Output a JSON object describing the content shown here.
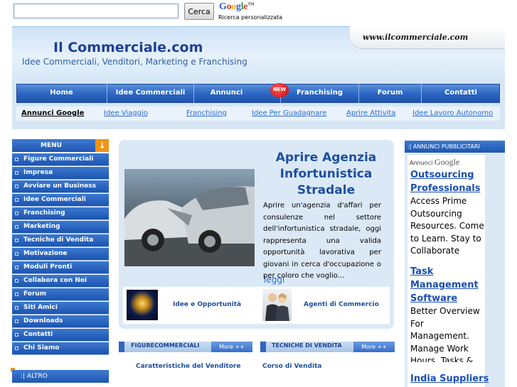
{
  "search": {
    "input_value": "",
    "button_label": "Cerca",
    "google_logo": "Google",
    "google_tm": "TM",
    "subtitle": "Ricerca personalizzata"
  },
  "header": {
    "site_url": "www.ilcommerciale.com",
    "title": "Il Commerciale.com",
    "subtitle": "Idee Commerciali, Venditori, Marketing e Franchising"
  },
  "nav": {
    "items": [
      {
        "label": "Home"
      },
      {
        "label": "Idee Commerciali"
      },
      {
        "label": "Annunci"
      },
      {
        "label": "Franchising"
      },
      {
        "label": "Forum"
      },
      {
        "label": "Contatti"
      }
    ],
    "new_badge": "NEW"
  },
  "subnav": {
    "items": [
      {
        "label": "Annunci Google"
      },
      {
        "label": "Idee Viaggio"
      },
      {
        "label": "Franchising"
      },
      {
        "label": "Idee Per Guadagnare"
      },
      {
        "label": "Aprire Attivita"
      },
      {
        "label": "Idee Lavoro Autonomo"
      }
    ]
  },
  "menu": {
    "title": "MENU",
    "items": [
      {
        "label": "Figure Commerciali"
      },
      {
        "label": "Impresa"
      },
      {
        "label": "Avviare un Business"
      },
      {
        "label": "Idee Commerciali"
      },
      {
        "label": "Franchising"
      },
      {
        "label": "Marketing"
      },
      {
        "label": "Tecniche di Vendita"
      },
      {
        "label": "Motivazione"
      },
      {
        "label": "Moduli Pronti"
      },
      {
        "label": "Collabora con Noi"
      },
      {
        "label": "Forum"
      },
      {
        "label": "Siti Amici"
      },
      {
        "label": "Downloads"
      },
      {
        "label": "Contatti"
      },
      {
        "label": "Chi Siamo"
      }
    ],
    "altro": ":| ALTRO"
  },
  "feature": {
    "title": "Aprire Agenzia Infortunistica Stradale",
    "text": "Aprire un'agenzia d'affari per consulenze nel settore dell'infortunistica stradale, oggi rappresenta una valida opportunità lavorativa per giovani in cerca d'occupazione o per coloro che voglio...",
    "more": "leggi",
    "link1": "Idee e Opportunità",
    "link2": "Agenti di Commercio"
  },
  "sections": {
    "left_title": "FIGURECOMMERCIALI",
    "right_title": "TECNICHE DI VENDITA",
    "more": "More ++",
    "left_link": "Caratteristiche del Venditore",
    "right_link": "Corso di Vendita"
  },
  "ads": {
    "head": ":| ANNUNCI PUBBLICITARI",
    "by": "Annunci",
    "by_brand": "Google",
    "ad1_title_l1": "Outsourcing",
    "ad1_title_l2": "Professionals",
    "ad1_body": "Access Prime Outsourcing Resources. Come to Learn. Stay to Collaborate",
    "ad2_title_l1": "Task",
    "ad2_title_l2": "Management",
    "ad2_title_l3": "Software",
    "ad2_body": "Better Overview For Management. Manage Work Hours, Tasks &",
    "ad3_title": "India Suppliers"
  }
}
